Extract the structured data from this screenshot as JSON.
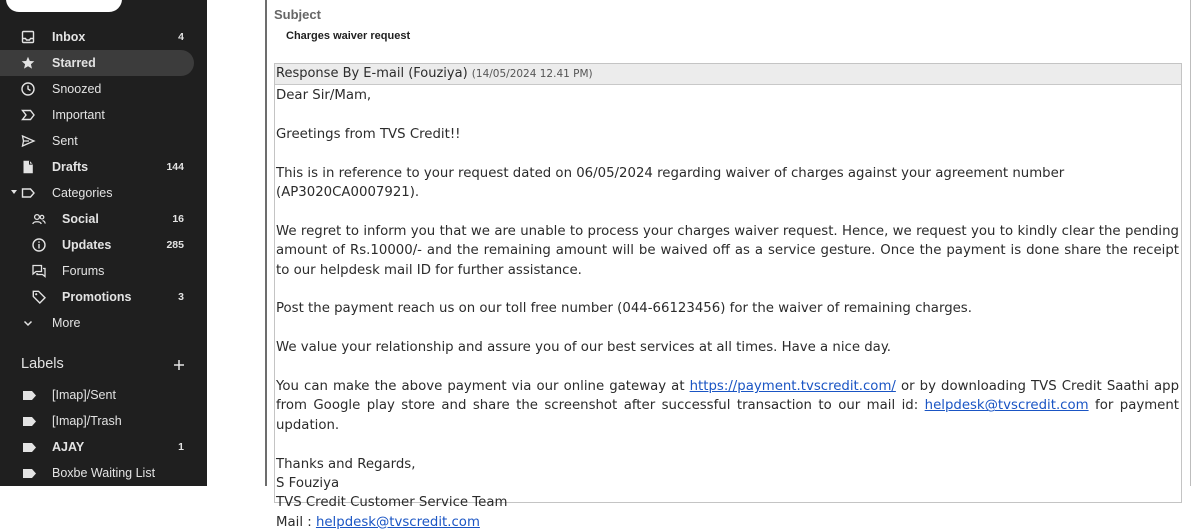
{
  "sidebar": {
    "nav": [
      {
        "label": "Inbox",
        "count": "4",
        "icon": "inbox-icon",
        "bold": true
      },
      {
        "label": "Starred",
        "count": "",
        "icon": "star-icon",
        "bold": true,
        "active": true
      },
      {
        "label": "Snoozed",
        "count": "",
        "icon": "clock-icon"
      },
      {
        "label": "Important",
        "count": "",
        "icon": "important-icon"
      },
      {
        "label": "Sent",
        "count": "",
        "icon": "send-icon"
      },
      {
        "label": "Drafts",
        "count": "144",
        "icon": "draft-icon",
        "bold": true
      },
      {
        "label": "Categories",
        "count": "",
        "icon": "label-outline-icon"
      },
      {
        "label": "Social",
        "count": "16",
        "icon": "people-icon",
        "bold": true
      },
      {
        "label": "Updates",
        "count": "285",
        "icon": "info-icon",
        "bold": true
      },
      {
        "label": "Forums",
        "count": "",
        "icon": "forum-icon"
      },
      {
        "label": "Promotions",
        "count": "3",
        "icon": "tag-icon",
        "bold": true
      },
      {
        "label": "More",
        "count": "",
        "icon": "chevron-down-icon"
      }
    ],
    "labels_heading": "Labels",
    "labels": [
      {
        "label": "[Imap]/Sent",
        "count": ""
      },
      {
        "label": "[Imap]/Trash",
        "count": ""
      },
      {
        "label": "AJAY",
        "count": "1",
        "bold": true
      },
      {
        "label": "Boxbe Waiting List",
        "count": ""
      }
    ]
  },
  "message": {
    "subject_label": "Subject",
    "subject_value": "Charges waiver request",
    "response_title": "Response By E-mail (Fouziya)",
    "response_date": "(14/05/2024 12.41 PM)",
    "greeting": "Dear Sir/Mam,",
    "greetings_line": "Greetings from TVS Credit!!",
    "para_reference": "This is in reference to your request dated on 06/05/2024 regarding waiver of charges against your agreement number (AP3020CA0007921).",
    "para_regret": "We regret to inform you that we are unable to process your charges waiver request. Hence, we request you to kindly clear the pending amount  of  Rs.10000/- and the remaining amount  will be waived off as a service gesture. Once the payment is done share the receipt to our helpdesk mail ID for further assistance.",
    "para_post": "Post the payment reach us on our toll free number (044-66123456) for the waiver of remaining charges.",
    "para_value": "We value your relationship and assure you of our best services at all times. Have a nice day.",
    "pay_pre": "You can make the above payment via our online gateway at ",
    "pay_link": "https://payment.tvscredit.com/",
    "pay_mid": " or by downloading TVS Credit Saathi app from Google play store and share the screenshot after successful transaction to our mail id: ",
    "pay_mail": "helpdesk@tvscredit.com",
    "pay_post": " for payment updation.",
    "thanks": "Thanks and Regards,",
    "signer": "S Fouziya",
    "team": "TVS Credit Customer Service Team",
    "mail_label": "Mail : ",
    "mail_link": "helpdesk@tvscredit.com"
  },
  "colors": {
    "sidebar_bg": "#1f1f1f",
    "sidebar_text": "#e3e3e3",
    "active_bg": "#3c3c3c",
    "link": "#1a55c4"
  }
}
